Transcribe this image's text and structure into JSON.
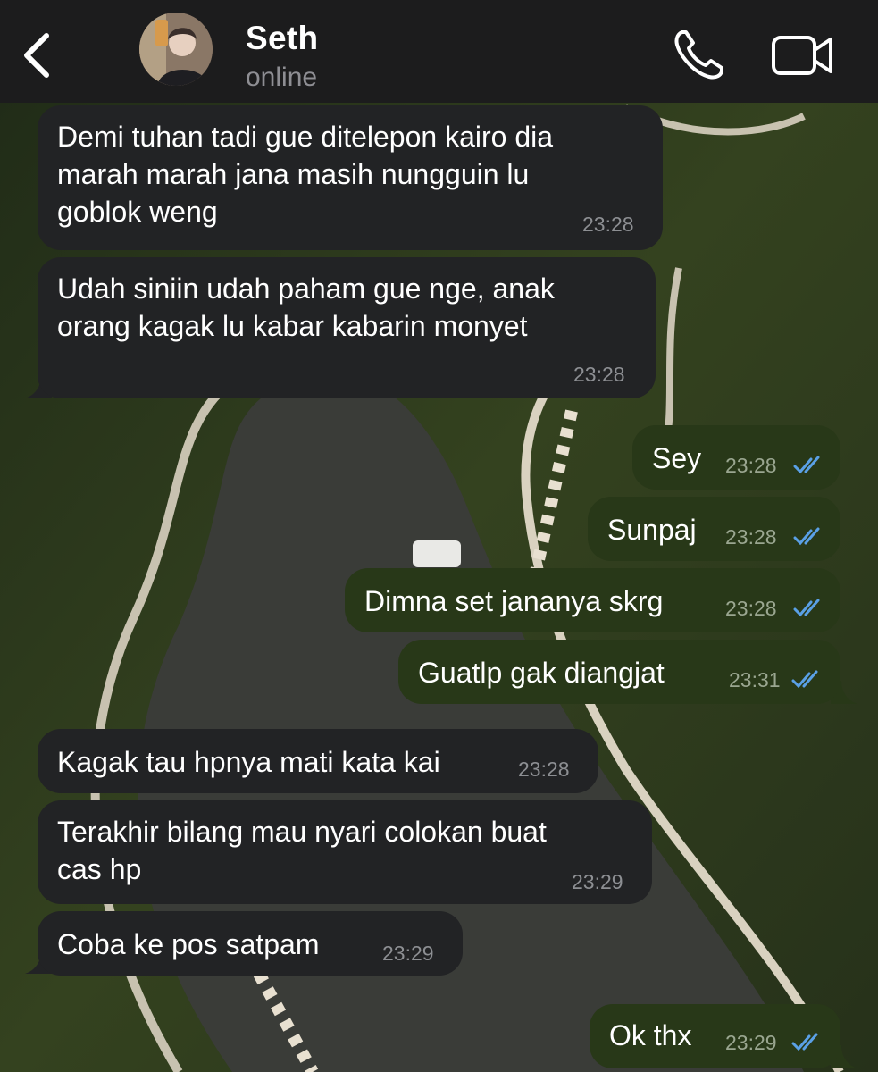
{
  "header": {
    "back_icon": "chevron-left-icon",
    "contact_name": "Seth",
    "contact_status": "online",
    "call_icon": "phone-icon",
    "video_icon": "video-camera-icon"
  },
  "colors": {
    "header_bg": "#1c1c1d",
    "incoming_bubble": "#222325",
    "outgoing_bubble": "#283818",
    "read_ticks": "#5aa0e6"
  },
  "messages": [
    {
      "direction": "in",
      "text": "Demi tuhan tadi gue ditelepon kairo dia\nmarah marah jana masih nungguin lu\ngoblok weng",
      "time": "23:28"
    },
    {
      "direction": "in",
      "text": "Udah siniin udah paham gue nge, anak\norang kagak lu kabar kabarin monyet",
      "time": "23:28"
    },
    {
      "direction": "out",
      "text": "Sey",
      "time": "23:28",
      "status": "read"
    },
    {
      "direction": "out",
      "text": "Sunpaj",
      "time": "23:28",
      "status": "read"
    },
    {
      "direction": "out",
      "text": "Dimna set jananya skrg",
      "time": "23:28",
      "status": "read"
    },
    {
      "direction": "out",
      "text": "Guatlp gak diangjat",
      "time": "23:31",
      "status": "read"
    },
    {
      "direction": "in",
      "text": "Kagak tau hpnya mati kata kai",
      "time": "23:28"
    },
    {
      "direction": "in",
      "text": "Terakhir bilang mau nyari colokan buat\ncas hp",
      "time": "23:29"
    },
    {
      "direction": "in",
      "text": "Coba ke pos satpam",
      "time": "23:29"
    },
    {
      "direction": "out",
      "text": "Ok thx",
      "time": "23:29",
      "status": "read"
    }
  ]
}
